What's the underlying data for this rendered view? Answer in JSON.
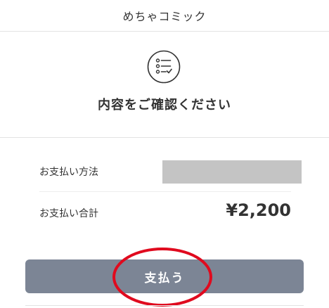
{
  "header": {
    "title": "めちゃコミック"
  },
  "confirm": {
    "icon": "checklist-icon",
    "heading": "内容をご確認ください"
  },
  "payment": {
    "method_label": "お支払い方法",
    "method_value": "",
    "total_label": "お支払い合計",
    "total_amount": "¥2,200"
  },
  "actions": {
    "pay_label": "支払う"
  },
  "colors": {
    "button_bg": "#7c8595",
    "annotation": "#e00a1e",
    "masked": "#c4c4c4"
  }
}
